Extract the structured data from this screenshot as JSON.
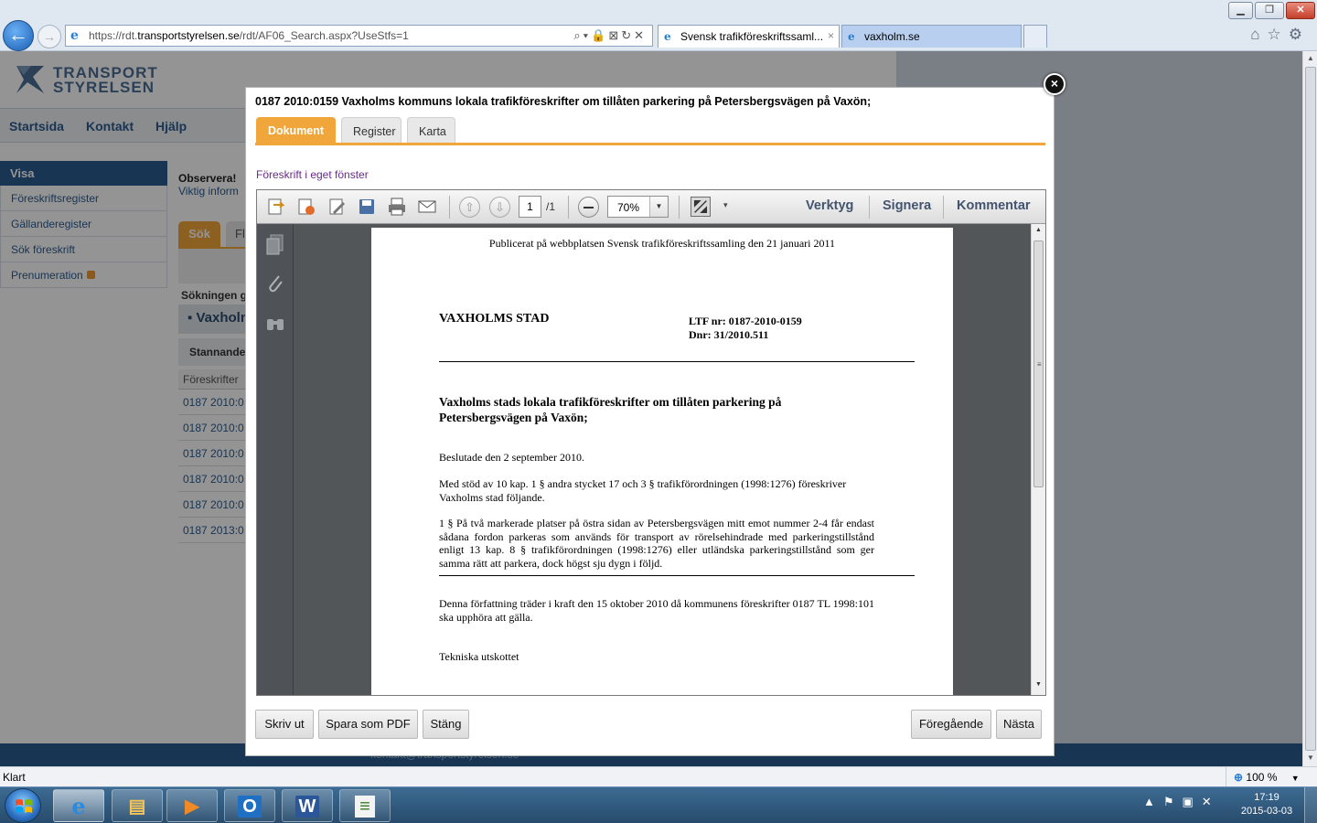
{
  "browser": {
    "window_controls": {
      "minimize": "▁",
      "maximize": "❐",
      "close": "✕"
    },
    "address": {
      "prefix": "https://rdt.",
      "domain": "transportstyrelsen.se",
      "path": "/rdt/AF06_Search.aspx?UseStfs=1",
      "icons": "⌕▾🔒⊠↻✕"
    },
    "tabs": [
      {
        "label": "Svensk trafikföreskriftssaml...",
        "close": "×",
        "active": true
      },
      {
        "label": "vaxholm.se",
        "active": false
      }
    ],
    "right_icons": "⌂☆⚙",
    "status_text": "Klart",
    "zoom": "100 %",
    "zoom_icon": "magnifier-icon"
  },
  "page": {
    "logo": {
      "line1": "TRANSPORT",
      "line2": "STYRELSEN"
    },
    "topnav": [
      "Startsida",
      "Kontakt",
      "Hjälp"
    ],
    "sidebar": {
      "heading": "Visa",
      "items": [
        "Föreskriftsregister",
        "Gällanderegister",
        "Sök föreskrift",
        "Prenumeration"
      ]
    },
    "observera": {
      "title": "Observera!",
      "text": "Viktig inform"
    },
    "search_tabs": [
      "Sök",
      "Fl"
    ],
    "sokningen": "Sökningen g",
    "vaxholm_bar": "▪ Vaxholm",
    "stannande": "Stannande",
    "results_header": "Föreskrifter",
    "results": [
      "0187 2010:0",
      "0187 2010:0",
      "0187 2010:0",
      "0187 2010:0",
      "0187 2010:0",
      "0187 2013:0"
    ],
    "footer_contact": "kontakt@transportstyrelsen.se"
  },
  "modal": {
    "title": "0187 2010:0159 Vaxholms kommuns lokala trafikföreskrifter om tillåten parkering på Petersbergsvägen på Vaxön;",
    "close_label": "×",
    "tabs": [
      "Dokument",
      "Register",
      "Karta"
    ],
    "separate_window_link": "Föreskrift i eget fönster",
    "toolbar": {
      "page_current": "1",
      "page_total": "/1",
      "zoom": "70%",
      "zoom_drop": "▼",
      "up": "⇧",
      "down": "⇩",
      "more": "▾",
      "tools": "Verktyg",
      "sign": "Signera",
      "comment": "Kommentar"
    },
    "document": {
      "published": "Publicerat på webbplatsen Svensk trafikföreskriftssamling den 21 januari 2011",
      "authority": "VAXHOLMS STAD",
      "ltf_nr": "LTF nr: 0187-2010-0159",
      "dnr": "Dnr: 31/2010.511",
      "heading_line1": "Vaxholms stads lokala trafikföreskrifter om tillåten parkering på",
      "heading_line2": "Petersbergsvägen på Vaxön;",
      "decided": "Beslutade den 2 september 2010.",
      "intro": "Med stöd av 10 kap. 1 § andra stycket 17  och 3 § trafikförordningen (1998:1276) föreskriver Vaxholms stad följande.",
      "paragraph1": "1 § På två markerade platser på östra sidan av Petersbergsvägen mitt emot nummer 2-4 får endast sådana fordon parkeras som används för transport av rörelsehindrade med parkeringstillstånd enligt 13 kap. 8 § trafikförordningen (1998:1276) eller utländska parkeringstillstånd som ger samma rätt att parkera, dock högst sju dygn i följd.",
      "effective": "Denna författning träder i kraft den 15 oktober 2010 då kommunens föreskrifter 0187 TL 1998:101 ska upphöra att gälla.",
      "signature": "Tekniska utskottet"
    },
    "buttons": {
      "print": "Skriv ut",
      "save_pdf": "Spara som PDF",
      "close": "Stäng",
      "previous": "Föregående",
      "next": "Nästa"
    }
  },
  "taskbar": {
    "tray_icons": "▲⚑▣✕",
    "time": "17:19",
    "date": "2015-03-03",
    "apps": [
      {
        "icon": "internet-explorer-icon",
        "glyph": "e"
      },
      {
        "icon": "file-explorer-icon",
        "glyph": "▤"
      },
      {
        "icon": "media-player-icon",
        "glyph": "▶"
      },
      {
        "icon": "outlook-icon",
        "glyph": "O"
      },
      {
        "icon": "word-icon",
        "glyph": "W"
      },
      {
        "icon": "notes-app-icon",
        "glyph": "≡"
      }
    ]
  }
}
